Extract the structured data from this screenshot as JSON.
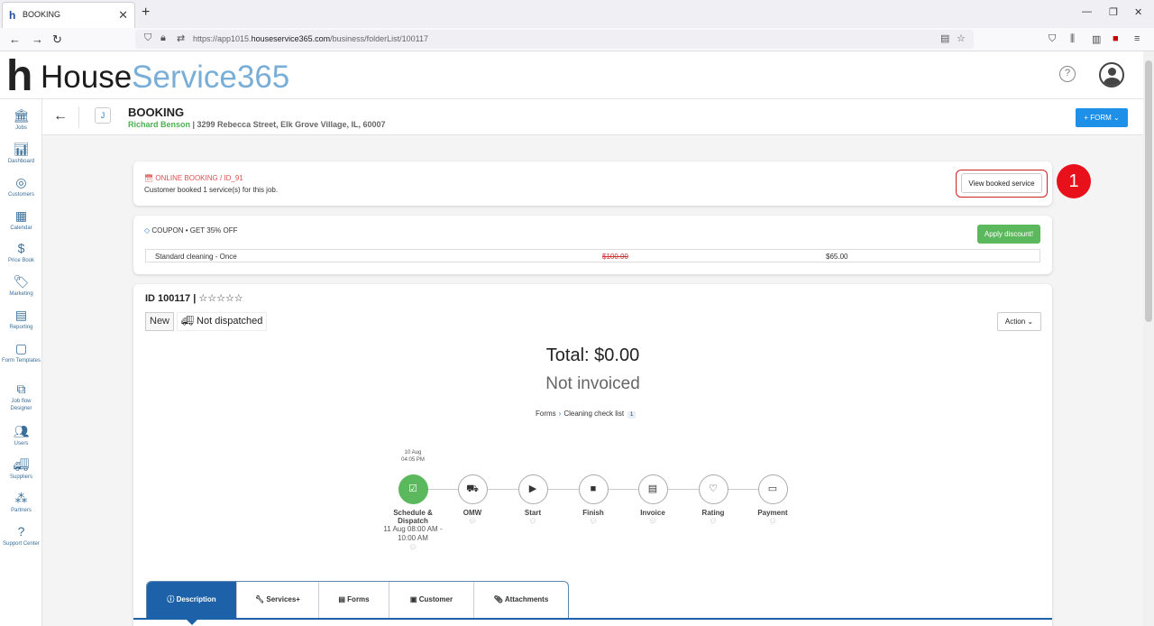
{
  "browser": {
    "tab_title": "BOOKING",
    "url_prefix": "https://app1015.",
    "url_domain": "houseservice365.com",
    "url_path": "/business/folderList/100117"
  },
  "app": {
    "logo_part1": "House",
    "logo_part2": "Service365"
  },
  "sidebar": {
    "items": [
      {
        "label": "Jobs",
        "icon": "jobs-icon"
      },
      {
        "label": "Dashboard",
        "icon": "dashboard-icon"
      },
      {
        "label": "Customers",
        "icon": "customers-icon"
      },
      {
        "label": "Calendar",
        "icon": "calendar-icon"
      },
      {
        "label": "Price Book",
        "icon": "price-book-icon"
      },
      {
        "label": "Marketing",
        "icon": "marketing-icon"
      },
      {
        "label": "Reporting",
        "icon": "reporting-icon"
      },
      {
        "label": "Form Templates",
        "icon": "form-templates-icon"
      },
      {
        "label": "Job flow Designer",
        "icon": "job-flow-icon"
      },
      {
        "label": "Users",
        "icon": "users-icon"
      },
      {
        "label": "Suppliers",
        "icon": "suppliers-icon"
      },
      {
        "label": "Partners",
        "icon": "partners-icon"
      },
      {
        "label": "Support Center",
        "icon": "support-icon"
      }
    ]
  },
  "header": {
    "badge": "J",
    "title": "BOOKING",
    "customer": "Richard Benson",
    "address": " | 3299 Rebecca Street, Elk Grove Village, IL, 60007",
    "form_button": "+ FORM ⌄"
  },
  "booking": {
    "label": "ONLINE BOOKING / ID_91",
    "description": "Customer booked 1 service(s) for this job.",
    "view_button": "View booked service",
    "marker": "1"
  },
  "coupon": {
    "label": "COUPON • GET 35% OFF",
    "apply_button": "Apply discount!",
    "service": "Standard cleaning - Once",
    "old_price": "$100.00",
    "new_price": "$65.00"
  },
  "job": {
    "id": "ID 100117 | ",
    "stars": "☆☆☆☆☆",
    "status": "New",
    "dispatch": "Not dispatched",
    "action": "Action ⌄",
    "total": "Total: $0.00",
    "invoiced": "Not invoiced",
    "forms_label": "Forms",
    "forms_item": "Cleaning check list",
    "forms_count": "1",
    "sched_top": "10 Aug 04:05 PM",
    "steps": [
      {
        "label": "Schedule & Dispatch",
        "date": "11 Aug 08:00 AM - 10:00 AM"
      },
      {
        "label": "OMW"
      },
      {
        "label": "Start"
      },
      {
        "label": "Finish"
      },
      {
        "label": "Invoice"
      },
      {
        "label": "Rating"
      },
      {
        "label": "Payment"
      }
    ]
  },
  "tabs": [
    {
      "label": "Description"
    },
    {
      "label": "Services+"
    },
    {
      "label": "Forms"
    },
    {
      "label": "Customer"
    },
    {
      "label": "Attachments"
    }
  ]
}
